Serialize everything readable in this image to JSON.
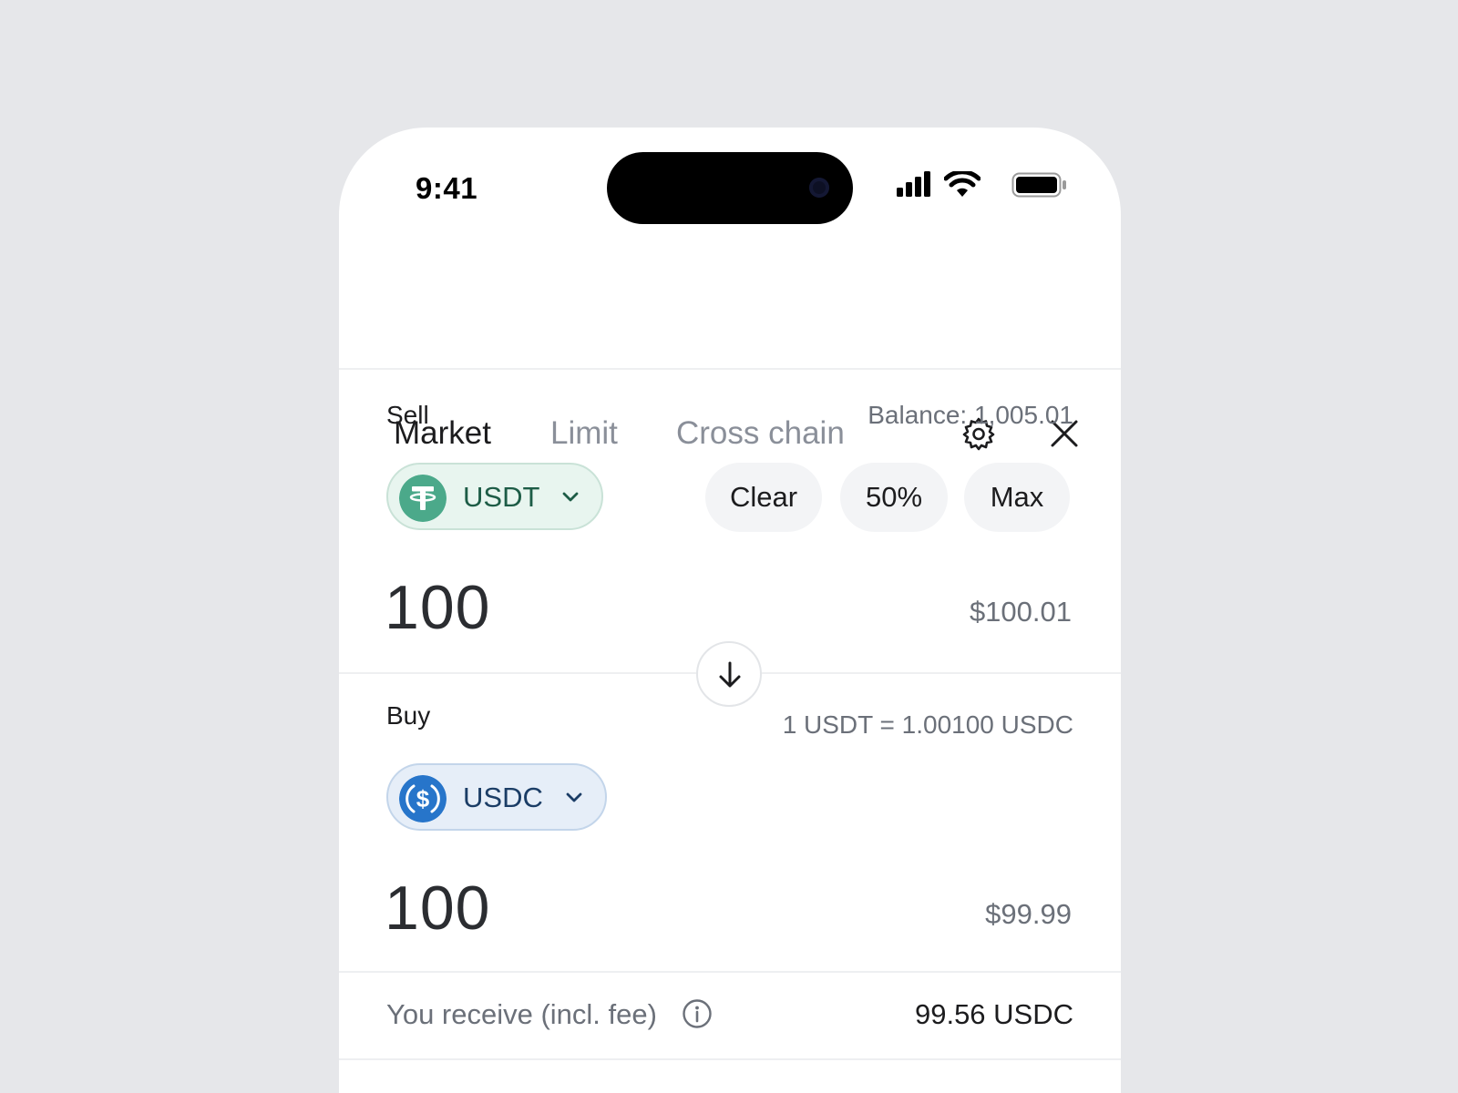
{
  "status_bar": {
    "time": "9:41"
  },
  "tabs": [
    {
      "label": "Market",
      "active": true
    },
    {
      "label": "Limit",
      "active": false
    },
    {
      "label": "Cross chain",
      "active": false
    }
  ],
  "header_icons": [
    "gear-icon",
    "close-icon"
  ],
  "sell": {
    "label": "Sell",
    "balance": "Balance: 1,005.01",
    "token": "USDT",
    "token_icon": "tether-icon",
    "token_color": "#26a17b",
    "chips": [
      "Clear",
      "50%",
      "Max"
    ],
    "amount": "100",
    "usd_value": "$100.01"
  },
  "buy": {
    "label": "Buy",
    "rate": "1 USDT = 1.00100 USDC",
    "token": "USDC",
    "token_icon": "usdc-icon",
    "token_color": "#2775ca",
    "amount": "100",
    "usd_value": "$99.99"
  },
  "receive": {
    "label": "You receive (incl. fee)",
    "value": "99.56 USDC"
  }
}
